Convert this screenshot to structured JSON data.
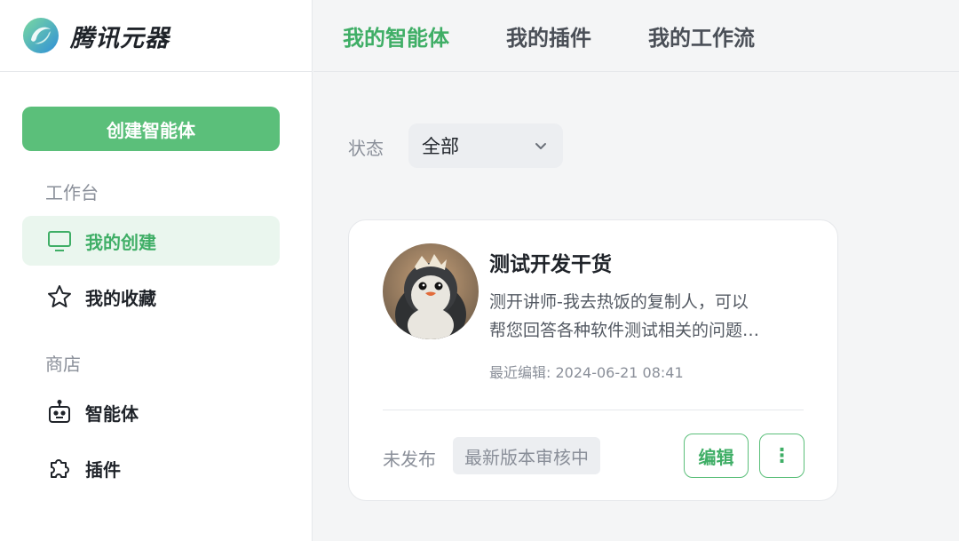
{
  "brand": {
    "name": "腾讯元器"
  },
  "sidebar": {
    "create_label": "创建智能体",
    "section_workbench": "工作台",
    "section_store": "商店",
    "items": [
      {
        "label": "我的创建",
        "icon": "monitor-icon",
        "active": true
      },
      {
        "label": "我的收藏",
        "icon": "star-icon",
        "active": false
      },
      {
        "label": "智能体",
        "icon": "robot-icon",
        "active": false
      },
      {
        "label": "插件",
        "icon": "puzzle-icon",
        "active": false
      }
    ]
  },
  "tabs": [
    {
      "label": "我的智能体",
      "active": true
    },
    {
      "label": "我的插件",
      "active": false
    },
    {
      "label": "我的工作流",
      "active": false
    }
  ],
  "filter": {
    "label": "状态",
    "value": "全部"
  },
  "card": {
    "title": "测试开发干货",
    "desc_line1": "测开讲师-我去热饭的复制人，可以",
    "desc_line2": "帮您回答各种软件测试相关的问题…",
    "last_edit": "最近编辑: 2024-06-21 08:41",
    "status": "未发布",
    "review": "最新版本审核中",
    "edit_label": "编辑",
    "more_label": "⋮"
  },
  "colors": {
    "accent": "#5bbf7a",
    "accent_text": "#3fae66",
    "active_bg": "#eaf6ee"
  }
}
